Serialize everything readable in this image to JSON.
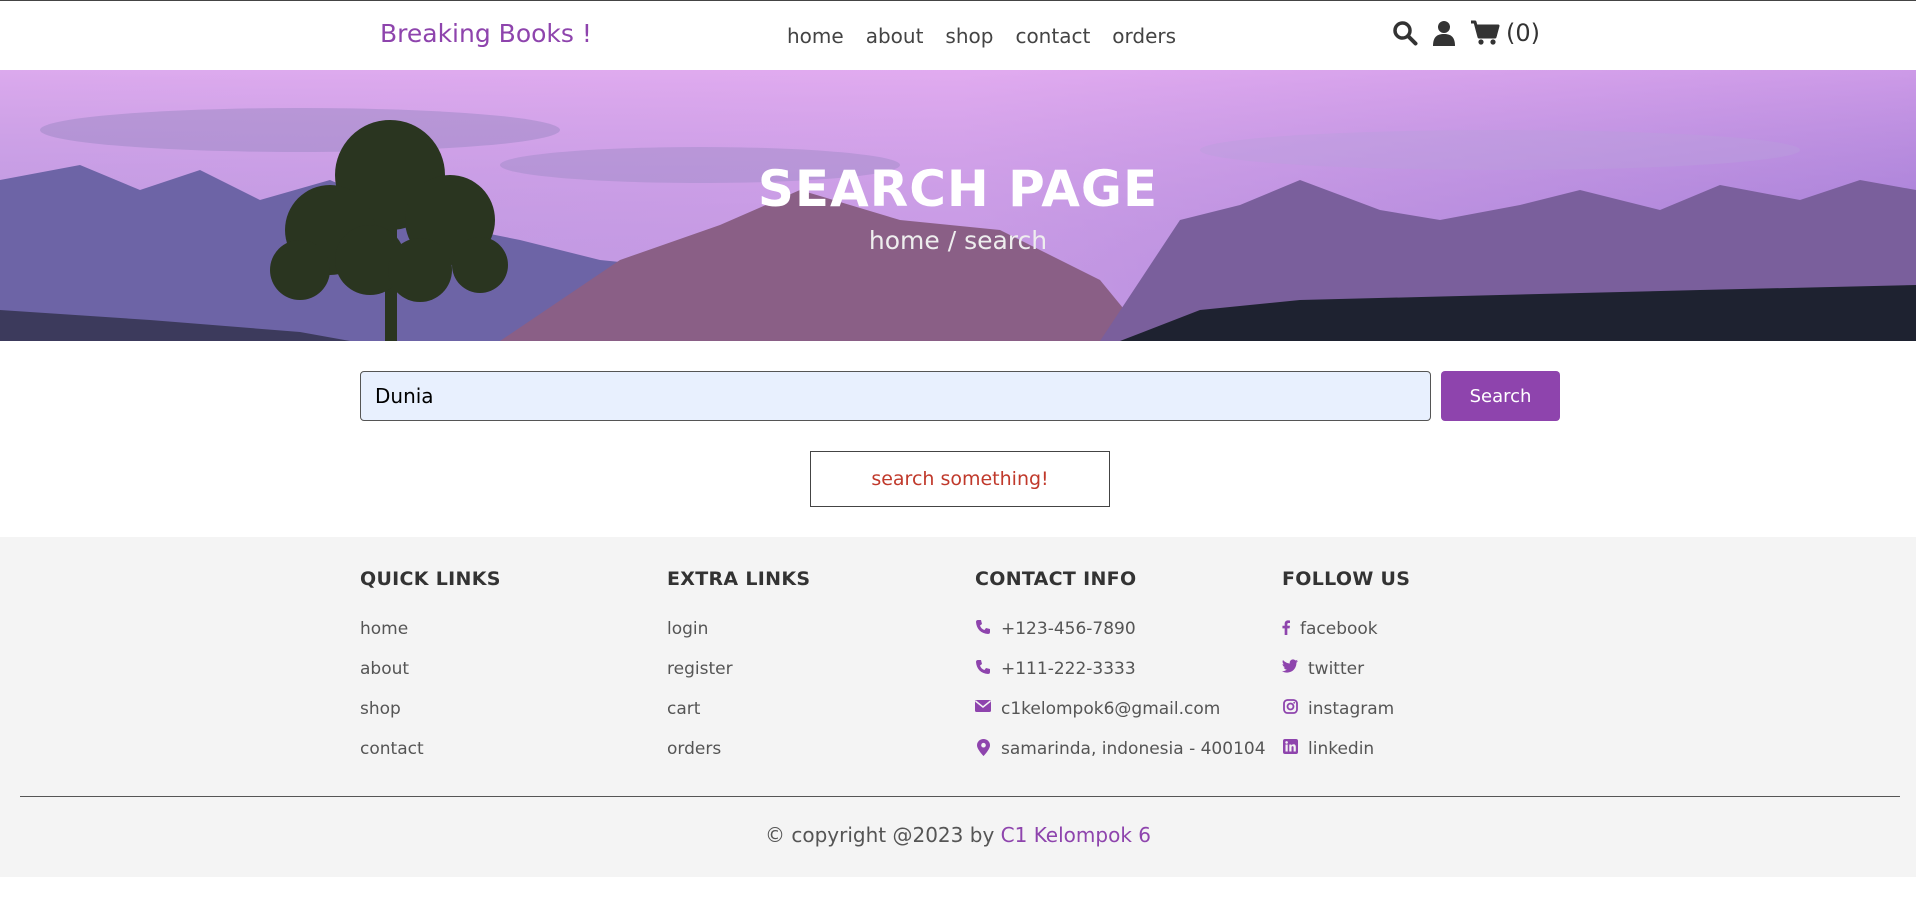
{
  "header": {
    "logo": "Breaking Books !",
    "nav": [
      "home",
      "about",
      "shop",
      "contact",
      "orders"
    ],
    "cart_count": "(0)",
    "icons": [
      "search-icon",
      "user-icon",
      "cart-icon"
    ]
  },
  "hero": {
    "title": "SEARCH PAGE",
    "breadcrumb": "home / search"
  },
  "search": {
    "value": "Dunia",
    "button_label": "Search",
    "empty_message": "search something!"
  },
  "footer": {
    "quick_links": {
      "title": "QUICK LINKS",
      "items": [
        "home",
        "about",
        "shop",
        "contact"
      ]
    },
    "extra_links": {
      "title": "EXTRA LINKS",
      "items": [
        "login",
        "register",
        "cart",
        "orders"
      ]
    },
    "contact_info": {
      "title": "CONTACT INFO",
      "items": [
        "+123-456-7890",
        "+111-222-3333",
        "c1kelompok6@gmail.com",
        "samarinda, indonesia - 400104"
      ]
    },
    "follow_us": {
      "title": "FOLLOW US",
      "items": [
        "facebook",
        "twitter",
        "instagram",
        "linkedin"
      ]
    },
    "credit_prefix": "© copyright @2023 by",
    "credit_name": "C1 Kelompok 6"
  },
  "colors": {
    "accent": "#8e44ad",
    "error": "#c0392b",
    "footer_bg": "#f4f4f4"
  }
}
